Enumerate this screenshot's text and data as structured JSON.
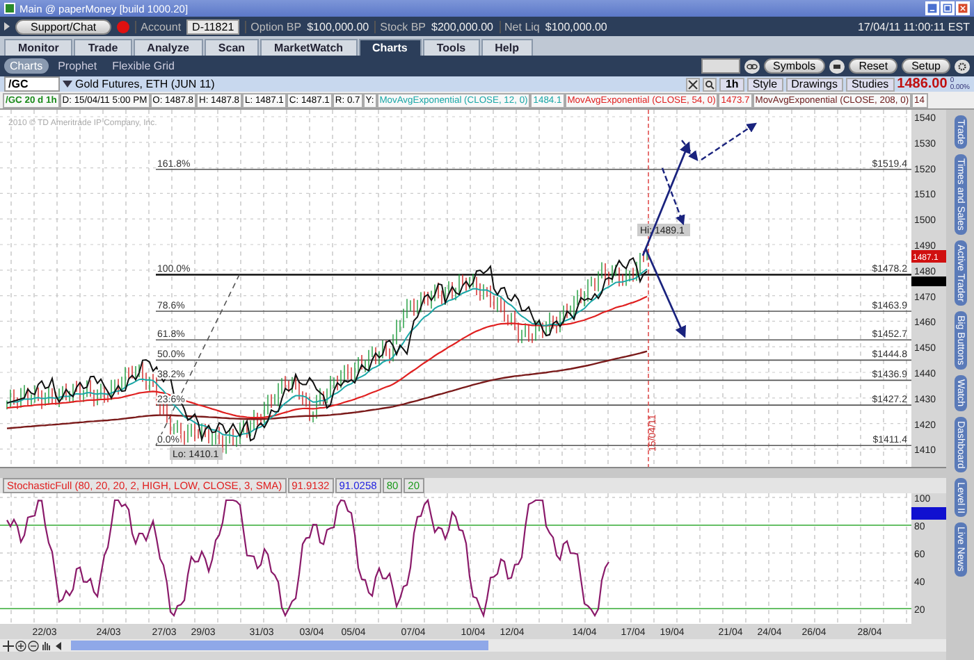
{
  "window": {
    "title": "Main @ paperMoney [build 1000.20]"
  },
  "account_bar": {
    "support_button": "Support/Chat",
    "account_label": "Account",
    "account_value": "D-11821",
    "fields": [
      {
        "label": "Option BP",
        "value": "$100,000.00"
      },
      {
        "label": "Stock BP",
        "value": "$200,000.00"
      },
      {
        "label": "Net Liq",
        "value": "$100,000.00"
      }
    ],
    "datetime": "17/04/11 11:00:11 EST"
  },
  "tabs": [
    {
      "label": "Monitor",
      "selected": false
    },
    {
      "label": "Trade",
      "selected": false
    },
    {
      "label": "Analyze",
      "selected": false
    },
    {
      "label": "Scan",
      "selected": false
    },
    {
      "label": "MarketWatch",
      "selected": false
    },
    {
      "label": "Charts",
      "selected": true
    },
    {
      "label": "Tools",
      "selected": false
    },
    {
      "label": "Help",
      "selected": false
    }
  ],
  "subtabs": [
    {
      "label": "Charts",
      "selected": true
    },
    {
      "label": "Prophet",
      "selected": false
    },
    {
      "label": "Flexible Grid",
      "selected": false
    }
  ],
  "toolbar_buttons": [
    "Symbols",
    "Reset",
    "Setup"
  ],
  "symbol_bar": {
    "symbol": "/GC",
    "description": "Gold Futures, ETH (JUN 11)",
    "interval": "1h",
    "buttons": [
      "Style",
      "Drawings",
      "Studies"
    ],
    "last_price": "1486.00",
    "change": "0",
    "change_percent": "0.00%"
  },
  "info_bar": {
    "title": "/GC 20 d 1h",
    "fields": [
      "D: 15/04/11 5:00 PM",
      "O: 1487.8",
      "H: 1487.8",
      "L: 1487.1",
      "C: 1487.1",
      "R: 0.7",
      "Y:"
    ],
    "studies": [
      {
        "name": "MovAvgExponential (CLOSE, 12, 0)",
        "value": "1484.1",
        "color": "#1aa7a7"
      },
      {
        "name": "MovAvgExponential (CLOSE, 54, 0)",
        "value": "1473.7",
        "color": "#e02020"
      },
      {
        "name": "MovAvgExponential (CLOSE, 208, 0)",
        "value": "14",
        "color": "#6b1a1a"
      }
    ]
  },
  "price_chart": {
    "copyright": "2010 © TD Ameritrade IP Company, Inc.",
    "y_axis": [
      "1540",
      "1530",
      "1520",
      "1510",
      "1500",
      "1490",
      "1480",
      "1470",
      "1460",
      "1450",
      "1440",
      "1430",
      "1420",
      "1410"
    ],
    "fib_levels": [
      {
        "label": "161.8%",
        "price": "$1519.4"
      },
      {
        "label": "100.0%",
        "price": "$1478.2"
      },
      {
        "label": "78.6%",
        "price": "$1463.9"
      },
      {
        "label": "61.8%",
        "price": "$1452.7"
      },
      {
        "label": "50.0%",
        "price": "$1444.8"
      },
      {
        "label": "38.2%",
        "price": "$1436.9"
      },
      {
        "label": "23.6%",
        "price": "$1427.2"
      },
      {
        "label": "0.0%",
        "price": "$1411.4"
      }
    ],
    "high_label": "Hi: 1489.1",
    "low_label": "Lo: 1410.1",
    "date_marker": "15/04/11",
    "price_tag": "1487.1"
  },
  "study_panel": {
    "title": "StochasticFull (80, 20, 20, 2, HIGH, LOW, CLOSE, 3, SMA)",
    "values": [
      {
        "text": "91.9132",
        "color": "#e02020"
      },
      {
        "text": "91.0258",
        "color": "#2020e0"
      },
      {
        "text": "80",
        "color": "#1a9a1a"
      },
      {
        "text": "20",
        "color": "#1a9a1a"
      }
    ],
    "y_axis": [
      "100",
      "80",
      "60",
      "40",
      "20"
    ]
  },
  "x_axis": [
    "22/03",
    "24/03",
    "27/03",
    "29/03",
    "31/03",
    "03/04",
    "05/04",
    "07/04",
    "10/04",
    "12/04",
    "14/04",
    "17/04",
    "19/04",
    "21/04",
    "24/04",
    "26/04",
    "28/04"
  ],
  "side_tabs": [
    "Trade",
    "Times and Sales",
    "Active Trader",
    "Big Buttons",
    "Watch",
    "Dashboard",
    "Level II",
    "Live News"
  ]
}
